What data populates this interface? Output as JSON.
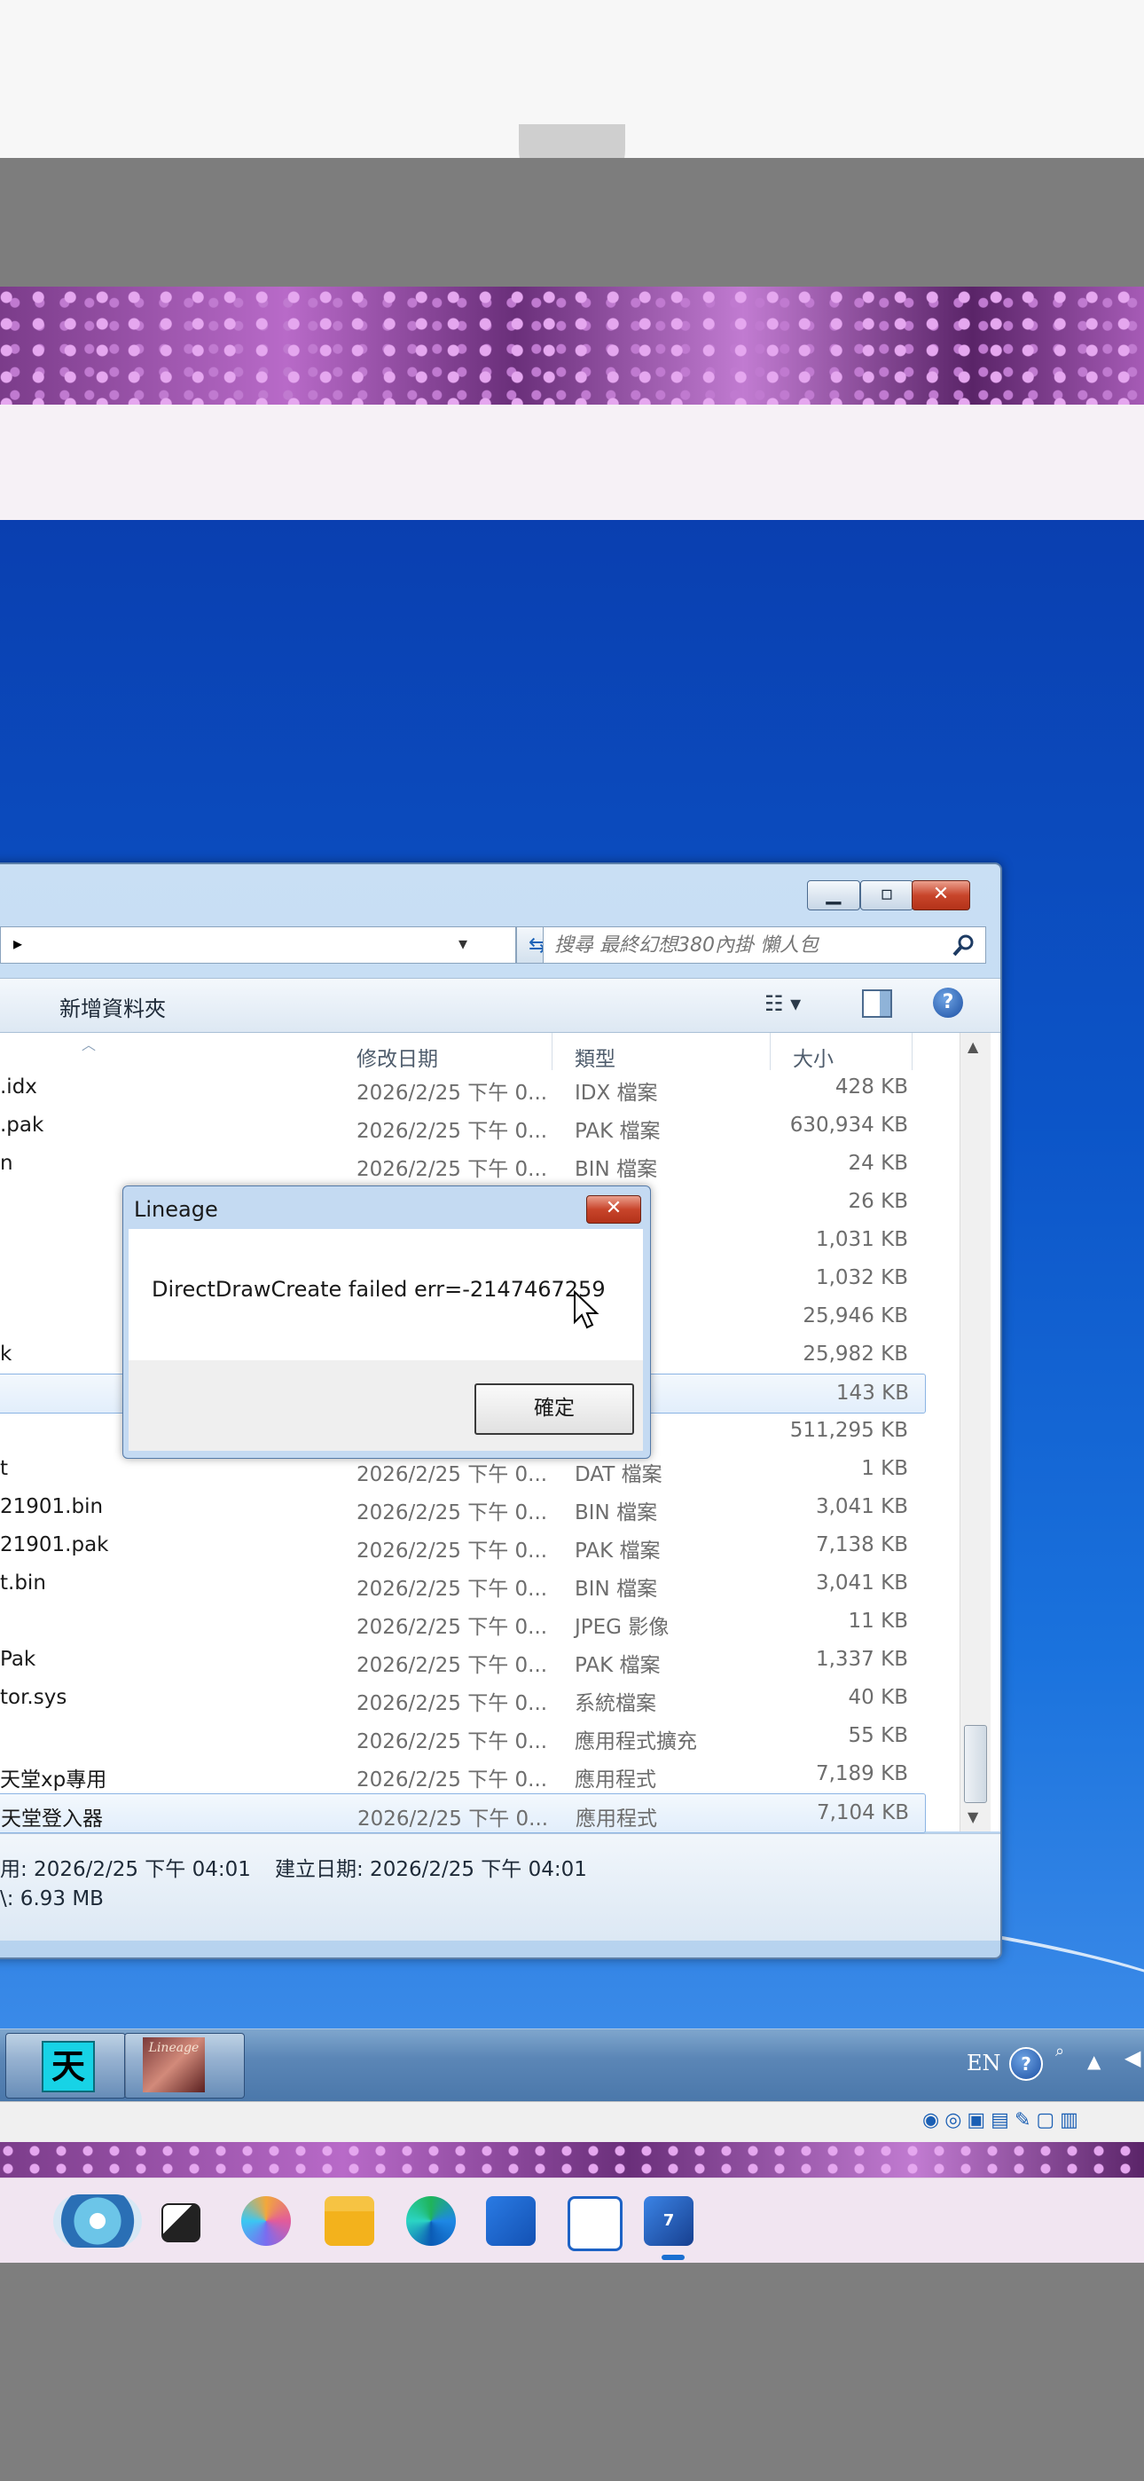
{
  "explorer": {
    "search_placeholder": "搜尋 最終幻想380內掛 懶人包",
    "new_folder": "新增資料夾",
    "columns": {
      "date": "修改日期",
      "type": "類型",
      "size": "大小"
    },
    "files": [
      {
        "name": ".idx",
        "date": "2026/2/25 下午 0...",
        "type": "IDX 檔案",
        "size": "428 KB"
      },
      {
        "name": ".pak",
        "date": "2026/2/25 下午 0...",
        "type": "PAK 檔案",
        "size": "630,934 KB"
      },
      {
        "name": "n",
        "date": "2026/2/25 下午 0...",
        "type": "BIN 檔案",
        "size": "24 KB"
      },
      {
        "name": "",
        "date": "",
        "type": "像",
        "size": "26 KB"
      },
      {
        "name": "",
        "date": "",
        "type": "",
        "size": "1,031 KB"
      },
      {
        "name": "",
        "date": "",
        "type": "案",
        "size": "1,032 KB"
      },
      {
        "name": "",
        "date": "",
        "type": "案",
        "size": "25,946 KB"
      },
      {
        "name": "k",
        "date": "",
        "type": "案",
        "size": "25,982 KB"
      },
      {
        "name": "",
        "date": "",
        "type": "案",
        "size": "143 KB"
      },
      {
        "name": "",
        "date": "",
        "type": "案",
        "size": "511,295 KB"
      },
      {
        "name": "t",
        "date": "2026/2/25 下午 0...",
        "type": "DAT 檔案",
        "size": "1 KB"
      },
      {
        "name": "21901.bin",
        "date": "2026/2/25 下午 0...",
        "type": "BIN 檔案",
        "size": "3,041 KB"
      },
      {
        "name": "21901.pak",
        "date": "2026/2/25 下午 0...",
        "type": "PAK 檔案",
        "size": "7,138 KB"
      },
      {
        "name": "t.bin",
        "date": "2026/2/25 下午 0...",
        "type": "BIN 檔案",
        "size": "3,041 KB"
      },
      {
        "name": "",
        "date": "2026/2/25 下午 0...",
        "type": "JPEG 影像",
        "size": "11 KB"
      },
      {
        "name": "Pak",
        "date": "2026/2/25 下午 0...",
        "type": "PAK 檔案",
        "size": "1,337 KB"
      },
      {
        "name": "tor.sys",
        "date": "2026/2/25 下午 0...",
        "type": "系統檔案",
        "size": "40 KB"
      },
      {
        "name": "",
        "date": "2026/2/25 下午 0...",
        "type": "應用程式擴充",
        "size": "55 KB"
      },
      {
        "name": "天堂xp專用",
        "date": "2026/2/25 下午 0...",
        "type": "應用程式",
        "size": "7,189 KB"
      },
      {
        "name": "天堂登入器",
        "date": "2026/2/25 下午 0...",
        "type": "應用程式",
        "size": "7,104 KB"
      }
    ],
    "details": {
      "modified": "用: 2026/2/25 下午 04:01",
      "created": "建立日期: 2026/2/25 下午 04:01",
      "size": "\\: 6.93 MB"
    }
  },
  "dialog": {
    "title": "Lineage",
    "message": "DirectDrawCreate failed err=-2147467259",
    "ok_label": "確定"
  },
  "taskbar7": {
    "tian_label": "天",
    "lineage_label": "Lineage",
    "language": "EN"
  }
}
